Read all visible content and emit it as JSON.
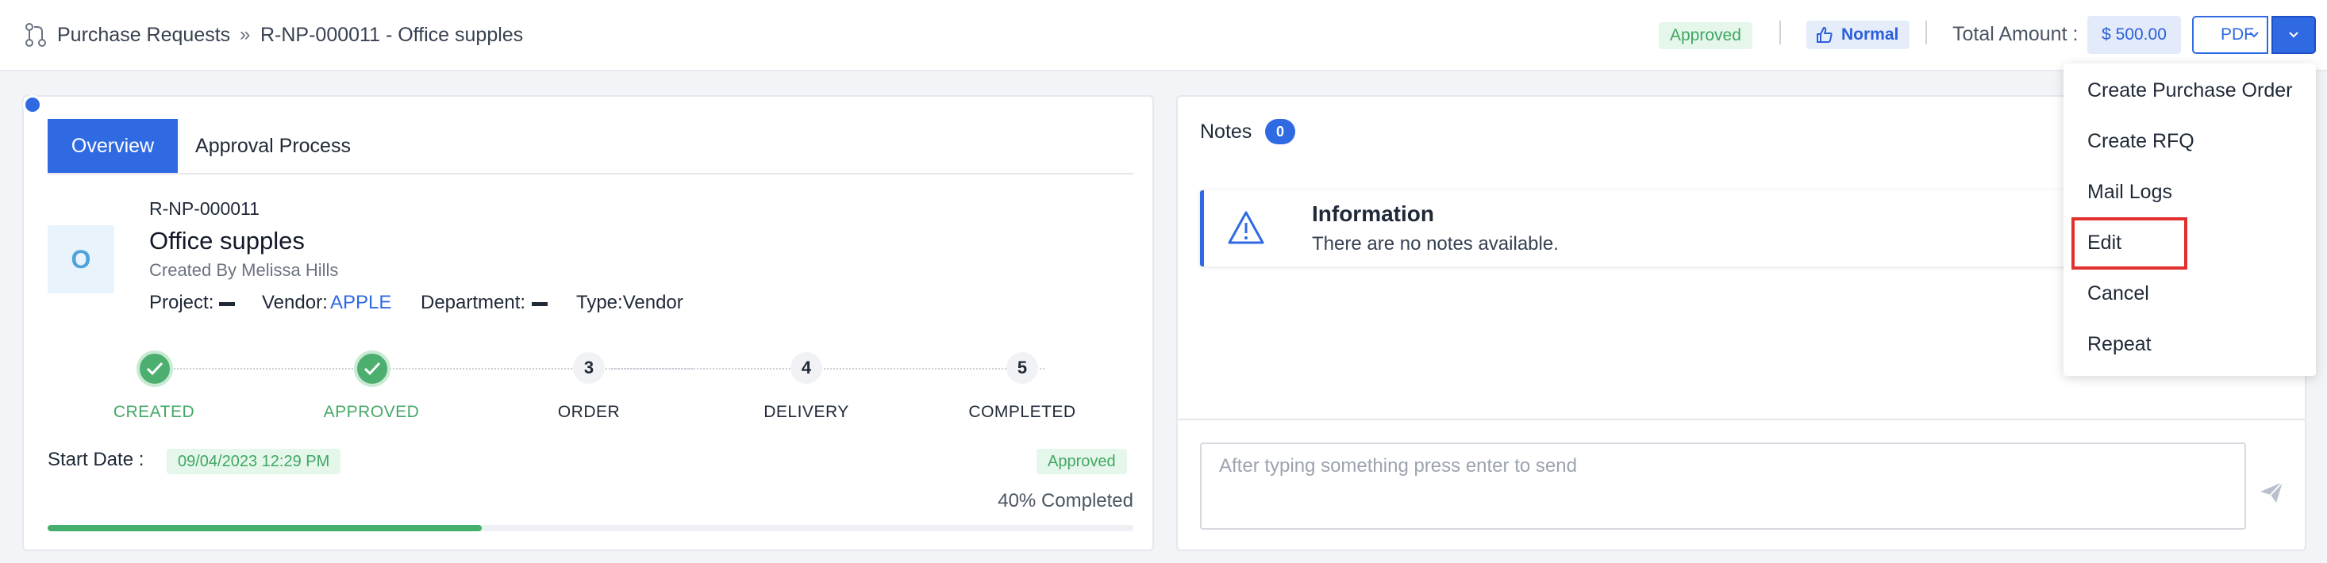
{
  "breadcrumb": {
    "icon": "git-pull-request-icon",
    "root": "Purchase Requests",
    "separator": "»",
    "current": "R-NP-000011 - Office supples"
  },
  "header": {
    "status": "Approved",
    "priority": "Normal",
    "priority_icon": "thumbs-up-icon",
    "total_label": "Total Amount :",
    "total_amount": "$ 500.00",
    "pdf_label": "PDF"
  },
  "tabs": [
    {
      "label": "Overview",
      "active": true
    },
    {
      "label": "Approval Process",
      "active": false
    }
  ],
  "request": {
    "avatar_letter": "O",
    "id": "R-NP-000011",
    "title": "Office supples",
    "created_by": "Created By Melissa Hills",
    "project_label": "Project:",
    "vendor_label": "Vendor:",
    "vendor_value": "APPLE",
    "department_label": "Department:",
    "type_label": "Type:Vendor"
  },
  "steps": [
    {
      "label": "CREATED",
      "done": true,
      "number": "1"
    },
    {
      "label": "APPROVED",
      "done": true,
      "number": "2"
    },
    {
      "label": "ORDER",
      "done": false,
      "number": "3"
    },
    {
      "label": "DELIVERY",
      "done": false,
      "number": "4"
    },
    {
      "label": "COMPLETED",
      "done": false,
      "number": "5"
    }
  ],
  "start": {
    "label": "Start Date :",
    "date": "09/04/2023 12:29 PM",
    "status": "Approved"
  },
  "progress": {
    "percent": 40,
    "text": "40% Completed"
  },
  "notes": {
    "label": "Notes",
    "count": "0",
    "info_title": "Information",
    "info_text": "There are no notes available.",
    "input_placeholder": "After typing something press enter to send"
  },
  "dropdown": {
    "items": [
      "Create Purchase Order",
      "Create RFQ",
      "Mail Logs",
      "Edit",
      "Cancel",
      "Repeat"
    ],
    "highlighted": "Edit"
  },
  "colors": {
    "primary": "#2f6ae3",
    "success": "#45a866",
    "highlight": "#e0312f"
  }
}
